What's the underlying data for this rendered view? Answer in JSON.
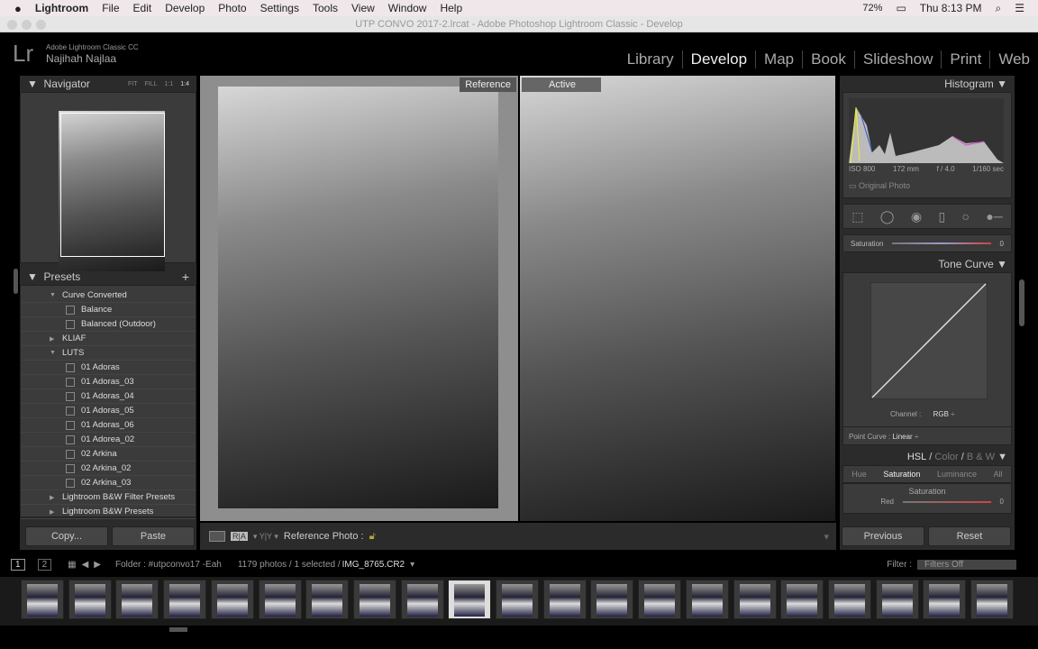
{
  "menubar": {
    "apple": "",
    "app": "Lightroom",
    "items": [
      "File",
      "Edit",
      "Develop",
      "Photo",
      "Settings",
      "Tools",
      "View",
      "Window",
      "Help"
    ],
    "battery": "72%",
    "clock": "Thu 8:13 PM"
  },
  "window_title": "UTP CONVO 2017-2.lrcat - Adobe Photoshop Lightroom Classic - Develop",
  "identity": {
    "logo": "Lr",
    "product": "Adobe Lightroom Classic CC",
    "user": "Najihah Najlaa"
  },
  "modules": [
    "Library",
    "Develop",
    "Map",
    "Book",
    "Slideshow",
    "Print",
    "Web"
  ],
  "active_module": "Develop",
  "navigator": {
    "title": "Navigator",
    "zoom_options": [
      "FIT",
      "FILL",
      "1:1",
      "1:4"
    ]
  },
  "presets": {
    "title": "Presets",
    "add": "+",
    "items": [
      {
        "label": "Curve Converted",
        "type": "folder",
        "open": true,
        "level": 1
      },
      {
        "label": "Balance",
        "type": "preset",
        "level": 2
      },
      {
        "label": "Balanced (Outdoor)",
        "type": "preset",
        "level": 2
      },
      {
        "label": "KLIAF",
        "type": "folder",
        "open": false,
        "level": 1
      },
      {
        "label": "LUTS",
        "type": "folder",
        "open": true,
        "level": 1
      },
      {
        "label": "01 Adoras",
        "type": "preset",
        "level": 2
      },
      {
        "label": "01 Adoras_03",
        "type": "preset",
        "level": 2
      },
      {
        "label": "01 Adoras_04",
        "type": "preset",
        "level": 2
      },
      {
        "label": "01 Adoras_05",
        "type": "preset",
        "level": 2
      },
      {
        "label": "01 Adoras_06",
        "type": "preset",
        "level": 2
      },
      {
        "label": "01 Adorea_02",
        "type": "preset",
        "level": 2
      },
      {
        "label": "02 Arkina",
        "type": "preset",
        "level": 2
      },
      {
        "label": "02 Arkina_02",
        "type": "preset",
        "level": 2
      },
      {
        "label": "02 Arkina_03",
        "type": "preset",
        "level": 2
      },
      {
        "label": "Lightroom B&W Filter Presets",
        "type": "folder",
        "open": false,
        "level": 1
      },
      {
        "label": "Lightroom B&W Presets",
        "type": "folder",
        "open": false,
        "level": 1
      }
    ]
  },
  "left_buttons": {
    "copy": "Copy...",
    "paste": "Paste"
  },
  "view": {
    "reference_label": "Reference",
    "active_label": "Active"
  },
  "toolbar": {
    "reference_photo": "Reference Photo :"
  },
  "histogram": {
    "title": "Histogram",
    "iso": "ISO 800",
    "focal": "172 mm",
    "aperture": "f / 4.0",
    "shutter": "1/160 sec",
    "original_photo": "Original Photo"
  },
  "basic": {
    "saturation_label": "Saturation",
    "saturation_value": "0"
  },
  "tone_curve": {
    "title": "Tone Curve",
    "channel_label": "Channel :",
    "channel_value": "RGB",
    "point_curve_label": "Point Curve :",
    "point_curve_value": "Linear"
  },
  "hsl": {
    "title_hsl": "HSL",
    "title_color": "Color",
    "title_bw": "B & W",
    "tabs": [
      "Hue",
      "Saturation",
      "Luminance",
      "All"
    ],
    "active_tab": "Saturation",
    "section": "Saturation",
    "row_label": "Red",
    "row_value": "0"
  },
  "right_buttons": {
    "previous": "Previous",
    "reset": "Reset"
  },
  "filmstrip": {
    "screens": [
      "1",
      "2"
    ],
    "folder": "Folder : #utpconvo17 -Eah",
    "count": "1179 photos / 1 selected /",
    "filename": "IMG_8765.CR2",
    "filter_label": "Filter :",
    "filter_value": "Filters Off",
    "thumbnail_count": 21,
    "selected_index": 9
  }
}
